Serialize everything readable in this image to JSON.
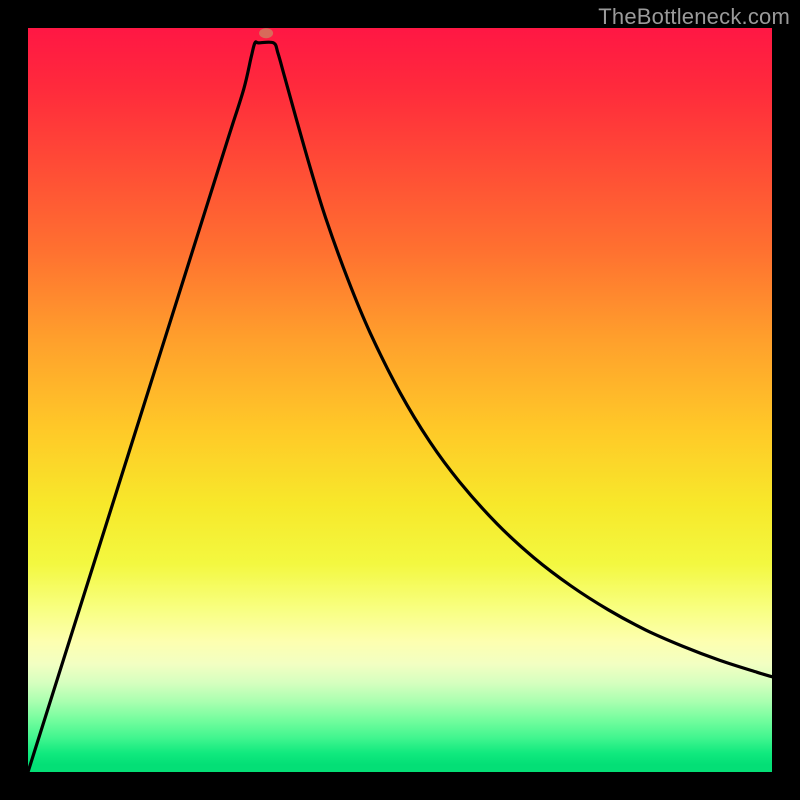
{
  "watermark": "TheBottleneck.com",
  "marker": {
    "x_frac": 0.32,
    "y_frac": 0.993,
    "rx": 7,
    "ry": 5
  },
  "chart_data": {
    "type": "line",
    "title": "",
    "xlabel": "",
    "ylabel": "",
    "x_range_frac": [
      0,
      1
    ],
    "y_range_frac": [
      0,
      1
    ],
    "series": [
      {
        "name": "bottleneck-curve",
        "axis": "xy_frac",
        "points": [
          [
            0.0,
            0.0
          ],
          [
            0.03,
            0.095
          ],
          [
            0.06,
            0.19
          ],
          [
            0.09,
            0.285
          ],
          [
            0.12,
            0.38
          ],
          [
            0.15,
            0.475
          ],
          [
            0.18,
            0.57
          ],
          [
            0.21,
            0.665
          ],
          [
            0.24,
            0.76
          ],
          [
            0.27,
            0.855
          ],
          [
            0.29,
            0.918
          ],
          [
            0.3,
            0.961
          ],
          [
            0.305,
            0.98
          ],
          [
            0.31,
            0.98
          ],
          [
            0.33,
            0.98
          ],
          [
            0.336,
            0.966
          ],
          [
            0.345,
            0.934
          ],
          [
            0.36,
            0.88
          ],
          [
            0.38,
            0.81
          ],
          [
            0.4,
            0.745
          ],
          [
            0.43,
            0.662
          ],
          [
            0.46,
            0.59
          ],
          [
            0.5,
            0.51
          ],
          [
            0.54,
            0.444
          ],
          [
            0.58,
            0.39
          ],
          [
            0.63,
            0.334
          ],
          [
            0.68,
            0.288
          ],
          [
            0.73,
            0.25
          ],
          [
            0.78,
            0.218
          ],
          [
            0.83,
            0.191
          ],
          [
            0.88,
            0.169
          ],
          [
            0.93,
            0.15
          ],
          [
            0.98,
            0.134
          ],
          [
            1.0,
            0.128
          ]
        ]
      }
    ],
    "marker": {
      "x_frac": 0.32,
      "y_frac": 0.993
    }
  }
}
